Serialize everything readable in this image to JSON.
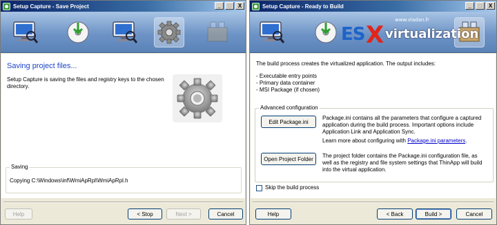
{
  "left": {
    "title": "Setup Capture - Save Project",
    "heading": "Saving project files...",
    "description": "Setup Capture is saving the files and registry keys to the chosen directory.",
    "saving_group_label": "Saving",
    "saving_path": "Copying C:\\Windows\\inf\\WmiApRpl\\WmiApRpl.h",
    "buttons": {
      "help": "Help",
      "stop": "< Stop",
      "next": "Next >",
      "cancel": "Cancel"
    }
  },
  "right": {
    "title": "Setup Capture - Ready to Build",
    "intro": "The build process creates the virtualized application. The output includes:",
    "outputs": [
      "- Executable entry points",
      "- Primary data container",
      "- MSI Package (if chosen)"
    ],
    "advanced_label": "Advanced configuration",
    "edit_button": "Edit Package.ini",
    "edit_desc": "Package.ini contains all the parameters that configure a captured application during the build process. Important options include Application Link and Application Sync.",
    "learn_more_prefix": "Learn more about configuring with ",
    "learn_more_link": "Package.ini parameters",
    "learn_more_suffix": ".",
    "open_button": "Open Project Folder",
    "open_desc": "The project folder contains the Package.ini configuration file, as well as the registry and file system settings that ThinApp will build into the virtual application.",
    "skip_label": "Skip the build process",
    "buttons": {
      "help": "Help",
      "back": "< Back",
      "build": "Build >",
      "cancel": "Cancel"
    },
    "watermark": {
      "url": "www.vladan.fr",
      "es": "ES",
      "x": "X",
      "rest": "virtualization"
    }
  },
  "titlebar_buttons": {
    "minimize": "_",
    "maximize": "□",
    "close": "X"
  },
  "icons": {
    "banner": [
      "monitor-magnifier-icon",
      "disc-install-icon",
      "monitor-magnifier-icon",
      "gear-icon",
      "package-icon"
    ],
    "large": "gear-icon"
  },
  "colors": {
    "heading": "#1a44c8",
    "link": "#0000cc",
    "banner": "#6e94c6"
  }
}
